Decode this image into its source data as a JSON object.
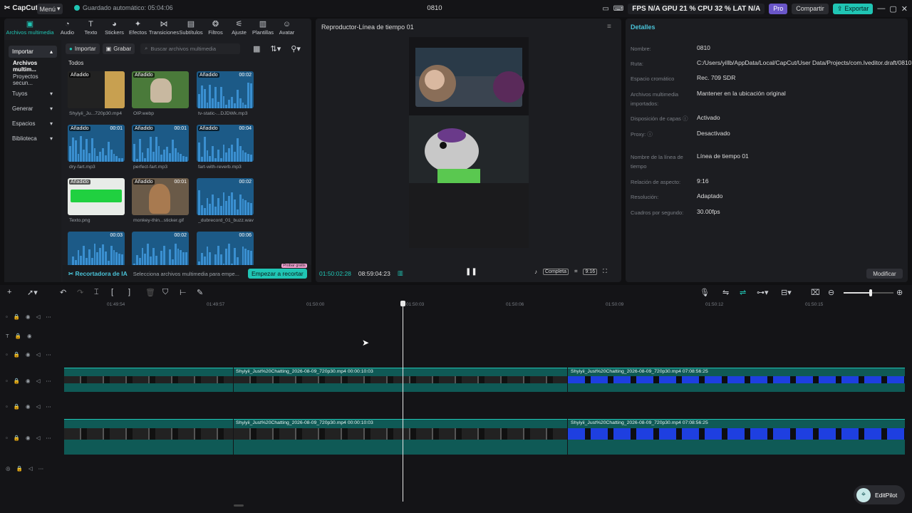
{
  "titlebar": {
    "app": "CapCut",
    "menu": "Menú",
    "autosave": "Guardado automático: 05:04:06",
    "project": "0810",
    "pro": "Pro",
    "share": "Compartir",
    "export": "Exportar",
    "stats": "FPS N/A  GPU 21 %  CPU 32 %  LAT N/A"
  },
  "tools": [
    "Archivos multimedia",
    "Audio",
    "Texto",
    "Stickers",
    "Efectos",
    "Transiciones",
    "Subtítulos",
    "Filtros",
    "Ajuste",
    "Plantillas",
    "Avatar"
  ],
  "sidebar": {
    "import": "Importar",
    "media": "Archivos multim...",
    "secondary": "Proyectos secun...",
    "yours": "Tuyos",
    "generate": "Generar",
    "spaces": "Espacios",
    "library": "Biblioteca"
  },
  "media_toolbar": {
    "import": "Importar",
    "record": "Grabar",
    "search_placeholder": "Buscar archivos multimedia"
  },
  "all_label": "Todos",
  "media": [
    {
      "name": "Shyiyii_Ju...720p30.mp4",
      "tag": "Añadido",
      "dur": ""
    },
    {
      "name": "OIP.webp",
      "tag": "Añadido",
      "dur": ""
    },
    {
      "name": "tv-static-...DJDWk.mp3",
      "tag": "Añadido",
      "dur": "00:02"
    },
    {
      "name": "dry-fart.mp3",
      "tag": "Añadido",
      "dur": "00:01"
    },
    {
      "name": "perfect-fart.mp3",
      "tag": "Añadido",
      "dur": "00:01"
    },
    {
      "name": "fart-with-reverb.mp3",
      "tag": "Añadido",
      "dur": "00:04"
    },
    {
      "name": "Texto.png",
      "tag": "Añadido",
      "dur": ""
    },
    {
      "name": "monkey-thin...sticker.gif",
      "tag": "Añadido",
      "dur": "00:01"
    },
    {
      "name": "_dubrecord_01_buzz.wav",
      "tag": "",
      "dur": "00:02"
    },
    {
      "name": "",
      "tag": "",
      "dur": "00:03"
    },
    {
      "name": "",
      "tag": "",
      "dur": "00:02"
    },
    {
      "name": "",
      "tag": "",
      "dur": "00:06"
    }
  ],
  "ai_cutter": {
    "title": "Recortadora de IA",
    "desc": "Selecciona archivos multimedia para empe...",
    "cta": "Empezar a recortar",
    "badge": "Probar gratis"
  },
  "player": {
    "title": "Reproductor-Línea de tiempo 01",
    "current": "01:50:02:28",
    "total": "08:59:04:23",
    "full": "Completa",
    "ratio": "9:16"
  },
  "details": {
    "title": "Detalles",
    "rows": [
      {
        "label": "Nombre:",
        "value": "0810"
      },
      {
        "label": "Ruta:",
        "value": "C:/Users/yillb/AppData/Local/CapCut/User Data/Projects/com.lveditor.draft/0810"
      },
      {
        "label": "Espacio cromático",
        "value": "Rec. 709 SDR"
      },
      {
        "label": "Archivos multimedia importados:",
        "value": "Mantener en la ubicación original"
      },
      {
        "label": "Disposición de capas",
        "value": "Activado"
      },
      {
        "label": "Proxy:",
        "value": "Desactivado"
      },
      {
        "label": "Nombre de la línea de tiempo",
        "value": "Línea de tiempo 01"
      },
      {
        "label": "Relación de aspecto:",
        "value": "9:16"
      },
      {
        "label": "Resolución:",
        "value": "Adaptado"
      },
      {
        "label": "Cuadros por segundo:",
        "value": "30.00fps"
      }
    ],
    "modify": "Modificar"
  },
  "ruler": [
    "01:49:54",
    "01:49:57",
    "01:50:00",
    "01:50:03",
    "01:50:06",
    "01:50:09",
    "01:50:12",
    "01:50:15"
  ],
  "clips": {
    "track1_a": "Shyiyii_Just%20Chatting_2026-08-09_720p30.mp4   00:00:10:03",
    "track1_b": "Shyiyii_Just%20Chatting_2026-08-09_720p30.mp4   07:08:56:25",
    "track2_a": "Shyiyii_Just%20Chatting_2026-08-09_720p30.mp4   00:00:10:03",
    "track2_b": "Shyiyii_Just%20Chatting_2026-08-09_720p30.mp4   07:08:56:25"
  },
  "editpilot": "EditPilot"
}
